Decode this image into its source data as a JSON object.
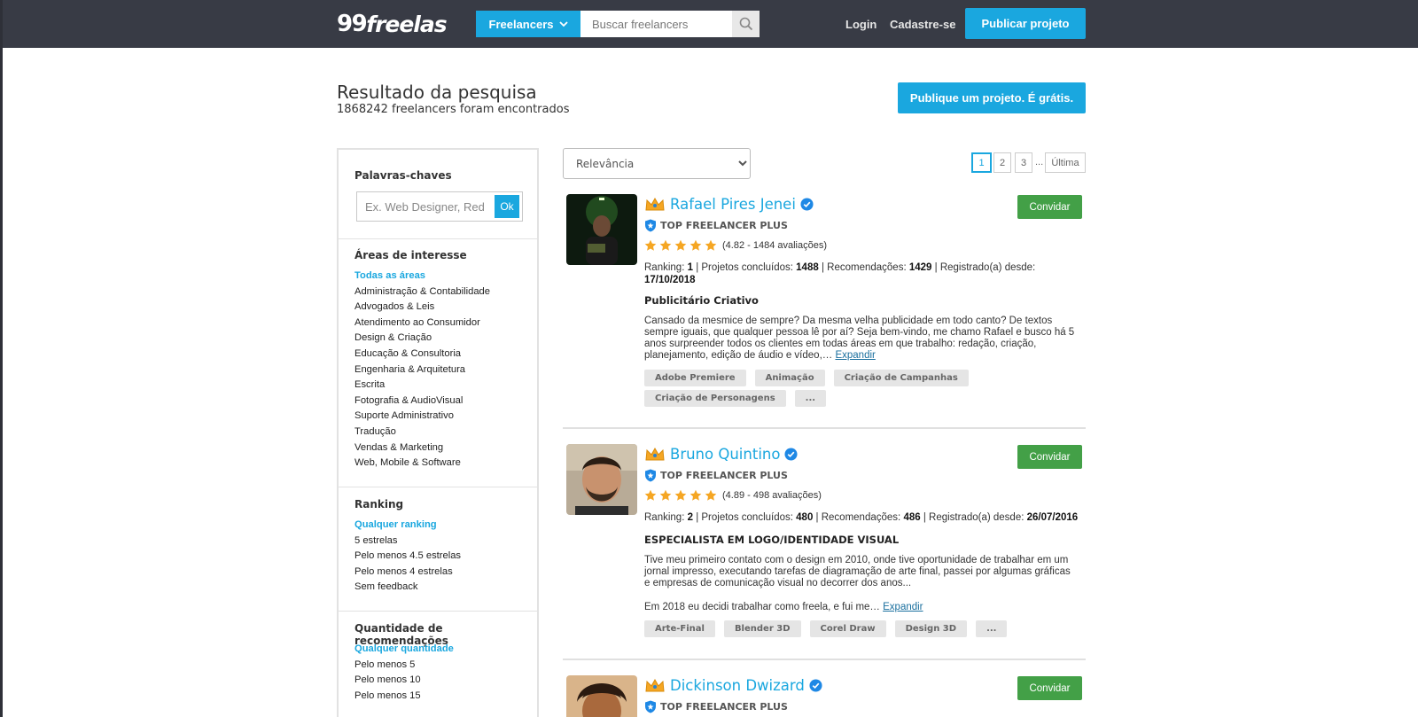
{
  "header": {
    "logo_main": "99",
    "logo_sub": "freelas",
    "category_button": "Freelancers",
    "search_placeholder": "Buscar freelancers",
    "login": "Login",
    "signup": "Cadastre-se",
    "publish": "Publicar projeto"
  },
  "page": {
    "title": "Resultado da pesquisa",
    "subtitle": "1868242 freelancers foram encontrados",
    "publish_free": "Publique um projeto. É grátis."
  },
  "sidebar": {
    "keywords_title": "Palavras-chaves",
    "keywords_placeholder": "Ex. Web Designer, Redator",
    "ok": "Ok",
    "areas_title": "Áreas de interesse",
    "areas": [
      "Todas as áreas",
      "Administração & Contabilidade",
      "Advogados & Leis",
      "Atendimento ao Consumidor",
      "Design & Criação",
      "Educação & Consultoria",
      "Engenharia & Arquitetura",
      "Escrita",
      "Fotografia & AudioVisual",
      "Suporte Administrativo",
      "Tradução",
      "Vendas & Marketing",
      "Web, Mobile & Software"
    ],
    "ranking_title": "Ranking",
    "ranking": [
      "Qualquer ranking",
      "5 estrelas",
      "Pelo menos 4.5 estrelas",
      "Pelo menos 4 estrelas",
      "Sem feedback"
    ],
    "recs_title": "Quantidade de recomendações",
    "recs": [
      "Qualquer quantidade",
      "Pelo menos 5",
      "Pelo menos 10",
      "Pelo menos 15"
    ]
  },
  "results": {
    "sort_value": "Relevância",
    "pages": [
      "1",
      "2",
      "3"
    ],
    "dots": "...",
    "last": "Última",
    "freelancers": [
      {
        "name": "Rafael Pires Jenei",
        "badge": "TOP FREELANCER PLUS",
        "rating_text": "(4.82 - 1484 avaliações)",
        "rating": 4.82,
        "ranking": "1",
        "projects": "1488",
        "recommendations": "1429",
        "registered": "17/10/2018",
        "headline": "Publicitário Criativo",
        "description": "Cansado da mesmice de sempre? Da mesma velha publicidade em todo canto? De textos sempre iguais, que qualquer pessoa lê por aí? Seja bem-vindo, me chamo Rafael e busco há 5 anos surpreender todos os clientes em todas áreas em que trabalho: redação, criação, planejamento, edição de áudio e vídeo,…",
        "description_extra": "",
        "expand": "Expandir",
        "tags": [
          "Adobe Premiere",
          "Animação",
          "Criação de Campanhas",
          "Criação de Personagens",
          "..."
        ],
        "invite": "Convidar"
      },
      {
        "name": "Bruno Quintino",
        "badge": "TOP FREELANCER PLUS",
        "rating_text": "(4.89 - 498 avaliações)",
        "rating": 4.89,
        "ranking": "2",
        "projects": "480",
        "recommendations": "486",
        "registered": "26/07/2016",
        "headline": "ESPECIALISTA EM LOGO/IDENTIDADE VISUAL",
        "description": "Tive meu primeiro contato com o design em 2010, onde tive oportunidade de trabalhar em um jornal impresso, executando tarefas de diagramação de arte final, passei por algumas gráficas e empresas de comunicação visual no decorrer dos anos...",
        "description_extra": "Em 2018 eu decidi trabalhar como freela, e fui me…",
        "expand": "Expandir",
        "tags": [
          "Arte-Final",
          "Blender 3D",
          "Corel Draw",
          "Design 3D",
          "..."
        ],
        "invite": "Convidar"
      },
      {
        "name": "Dickinson Dwizard",
        "badge": "TOP FREELANCER PLUS",
        "invite": "Convidar"
      }
    ],
    "stat_labels": {
      "ranking": "Ranking:",
      "projects": "Projetos concluídos:",
      "recommendations": "Recomendações:",
      "registered": "Registrado(a) desde:"
    }
  },
  "colors": {
    "accent": "#1aa7df",
    "header_bg": "#383b45",
    "invite_green": "#43a047",
    "star": "#f5a623"
  }
}
